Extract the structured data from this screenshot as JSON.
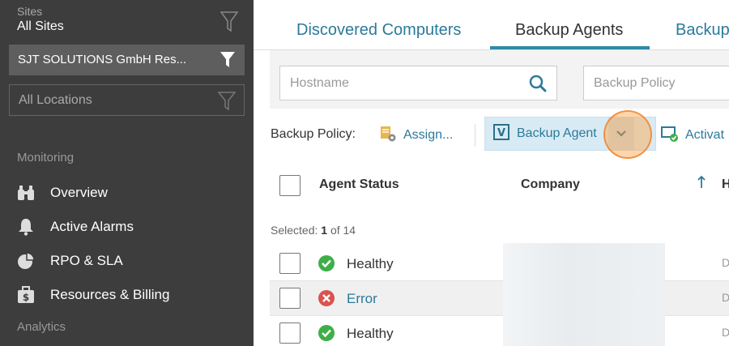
{
  "sidebar": {
    "sites_label": "Sites",
    "sites_value": "All Sites",
    "company": "SJT SOLUTIONS GmbH Res...",
    "locations": "All Locations",
    "sections": [
      {
        "label": "Monitoring"
      },
      {
        "label": "Analytics"
      }
    ],
    "items": [
      {
        "label": "Overview",
        "icon": "binoculars-icon"
      },
      {
        "label": "Active Alarms",
        "icon": "bell-icon"
      },
      {
        "label": "RPO & SLA",
        "icon": "pie-chart-icon"
      },
      {
        "label": "Resources & Billing",
        "icon": "billing-icon"
      }
    ]
  },
  "tabs": [
    {
      "label": "Discovered Computers",
      "active": false
    },
    {
      "label": "Backup Agents",
      "active": true
    },
    {
      "label": "Backup",
      "active": false
    }
  ],
  "filters": {
    "hostname_placeholder": "Hostname",
    "policy_placeholder": "Backup Policy"
  },
  "toolbar": {
    "label": "Backup Policy:",
    "assign": "Assign...",
    "backup_agent": "Backup Agent",
    "activate": "Activat"
  },
  "table": {
    "columns": [
      "Agent Status",
      "Company",
      "H"
    ],
    "selected_prefix": "Selected:",
    "selected_count": "1",
    "selected_suffix": "of 14",
    "rows": [
      {
        "status": "Healthy",
        "trail": "D"
      },
      {
        "status": "Error",
        "trail": "D"
      },
      {
        "status": "Healthy",
        "trail": "D"
      }
    ]
  },
  "colors": {
    "sidebar_bg": "#3d3d3d",
    "accent": "#2c8aa6",
    "link": "#2c7a9a",
    "healthy": "#3fae49",
    "error": "#d9534f"
  }
}
